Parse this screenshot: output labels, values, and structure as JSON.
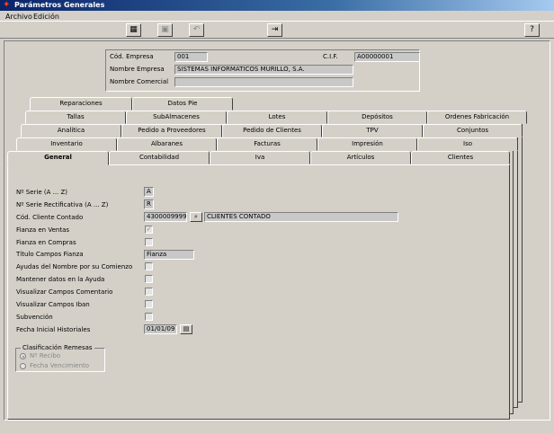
{
  "window": {
    "title": "Parámetros Generales"
  },
  "menu": {
    "archivo": "Archivo",
    "edicion": "Edición"
  },
  "toolbar": {
    "icons": [
      "grid-icon",
      "save-icon",
      "undo-icon",
      "exit-icon",
      "help-icon"
    ]
  },
  "header": {
    "cod_empresa_label": "Cód. Empresa",
    "cod_empresa_value": "001",
    "cif_label": "C.I.F.",
    "cif_value": "A00000001",
    "nombre_empresa_label": "Nombre Empresa",
    "nombre_empresa_value": "SISTEMAS INFORMATICOS MURILLO, S.A.",
    "nombre_comercial_label": "Nombre Comercial",
    "nombre_comercial_value": ""
  },
  "tabs": {
    "row1": [
      "Reparaciones",
      "Datos Pie"
    ],
    "row2": [
      "Tallas",
      "SubAlmacenes",
      "Lotes",
      "Depósitos",
      "Ordenes Fabricación"
    ],
    "row3": [
      "Analítica",
      "Pedido a Proveedores",
      "Pedido de Clientes",
      "TPV",
      "Conjuntos"
    ],
    "row4": [
      "Inventario",
      "Albaranes",
      "Facturas",
      "Impresión",
      "Iso"
    ],
    "row5": [
      "General",
      "Contabilidad",
      "Iva",
      "Artículos",
      "Clientes"
    ]
  },
  "general": {
    "serie_label": "Nº Serie (A ... Z)",
    "serie_value": "A",
    "serie_rect_label": "Nº Serie Rectificativa (A ... Z)",
    "serie_rect_value": "R",
    "cliente_contado_label": "Cód. Cliente Contado",
    "cliente_contado_code": "4300009999",
    "cliente_contado_name": "CLIENTES CONTADO",
    "fianza_ventas_label": "Fianza en Ventas",
    "fianza_compras_label": "Fianza en Compras",
    "titulo_campos_fianza_label": "Título Campos Fianza",
    "titulo_campos_fianza_value": "Fianza",
    "ayudas_label": "Ayudas del Nombre por su Comienzo",
    "mantener_label": "Mantener datos en la Ayuda",
    "visualizar_comentario_label": "Visualizar Campos Comentario",
    "visualizar_iban_label": "Visualizar Campos Iban",
    "subvencion_label": "Subvención",
    "fecha_inicial_label": "Fecha Inicial Historiales",
    "fecha_inicial_value": "01/01/09",
    "clasificacion_title": "Clasificación Remesas",
    "nro_recibo_label": "Nº Recibo",
    "fecha_vencimiento_label": "Fecha Vencimiento"
  }
}
